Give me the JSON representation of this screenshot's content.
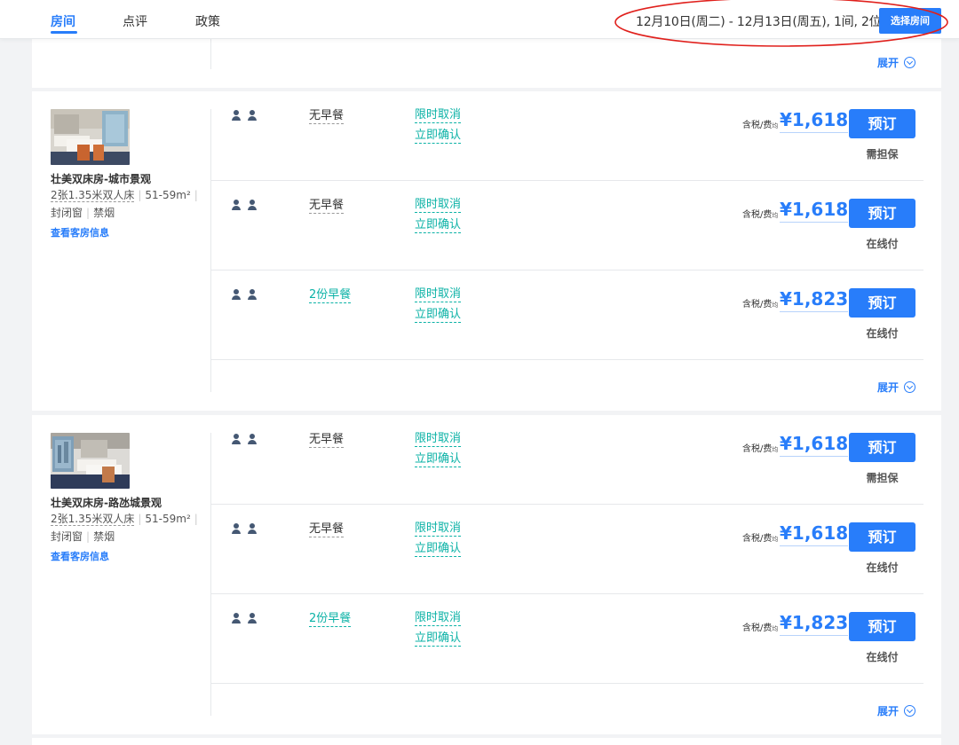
{
  "nav": {
    "tabs": [
      {
        "label": "房间",
        "active": true
      },
      {
        "label": "点评",
        "active": false
      },
      {
        "label": "政策",
        "active": false
      }
    ],
    "date_summary": "12月10日(周二) - 12月13日(周五), 1间, 2位",
    "select_room_button": "选择房间"
  },
  "colors": {
    "accent": "#287dfa",
    "policy_green": "#0bb2a6",
    "annotation_red": "#e0201c"
  },
  "expand_label": "展开",
  "rooms": [
    {
      "name": "壮美双床房-城市景观",
      "bed": "2张1.35米双人床",
      "area": "51-59m²",
      "window": "封闭窗",
      "smoking": "禁烟",
      "info_link": "查看客房信息",
      "rates": [
        {
          "meal": "无早餐",
          "policy": "限时取消",
          "confirm": "立即确认",
          "tax": "含税/费",
          "tax_small": "均",
          "price": "¥1,618",
          "book": "预订",
          "pay_note": "需担保"
        },
        {
          "meal": "无早餐",
          "policy": "限时取消",
          "confirm": "立即确认",
          "tax": "含税/费",
          "tax_small": "均",
          "price": "¥1,618",
          "book": "预订",
          "pay_note": "在线付"
        },
        {
          "meal": "2份早餐",
          "policy": "限时取消",
          "confirm": "立即确认",
          "tax": "含税/费",
          "tax_small": "均",
          "price": "¥1,823",
          "book": "预订",
          "pay_note": "在线付"
        }
      ]
    },
    {
      "name": "壮美双床房-路氹城景观",
      "bed": "2张1.35米双人床",
      "area": "51-59m²",
      "window": "封闭窗",
      "smoking": "禁烟",
      "info_link": "查看客房信息",
      "rates": [
        {
          "meal": "无早餐",
          "policy": "限时取消",
          "confirm": "立即确认",
          "tax": "含税/费",
          "tax_small": "均",
          "price": "¥1,618",
          "book": "预订",
          "pay_note": "需担保"
        },
        {
          "meal": "无早餐",
          "policy": "限时取消",
          "confirm": "立即确认",
          "tax": "含税/费",
          "tax_small": "均",
          "price": "¥1,618",
          "book": "预订",
          "pay_note": "在线付"
        },
        {
          "meal": "2份早餐",
          "policy": "限时取消",
          "confirm": "立即确认",
          "tax": "含税/费",
          "tax_small": "均",
          "price": "¥1,823",
          "book": "预订",
          "pay_note": "在线付"
        }
      ]
    }
  ]
}
